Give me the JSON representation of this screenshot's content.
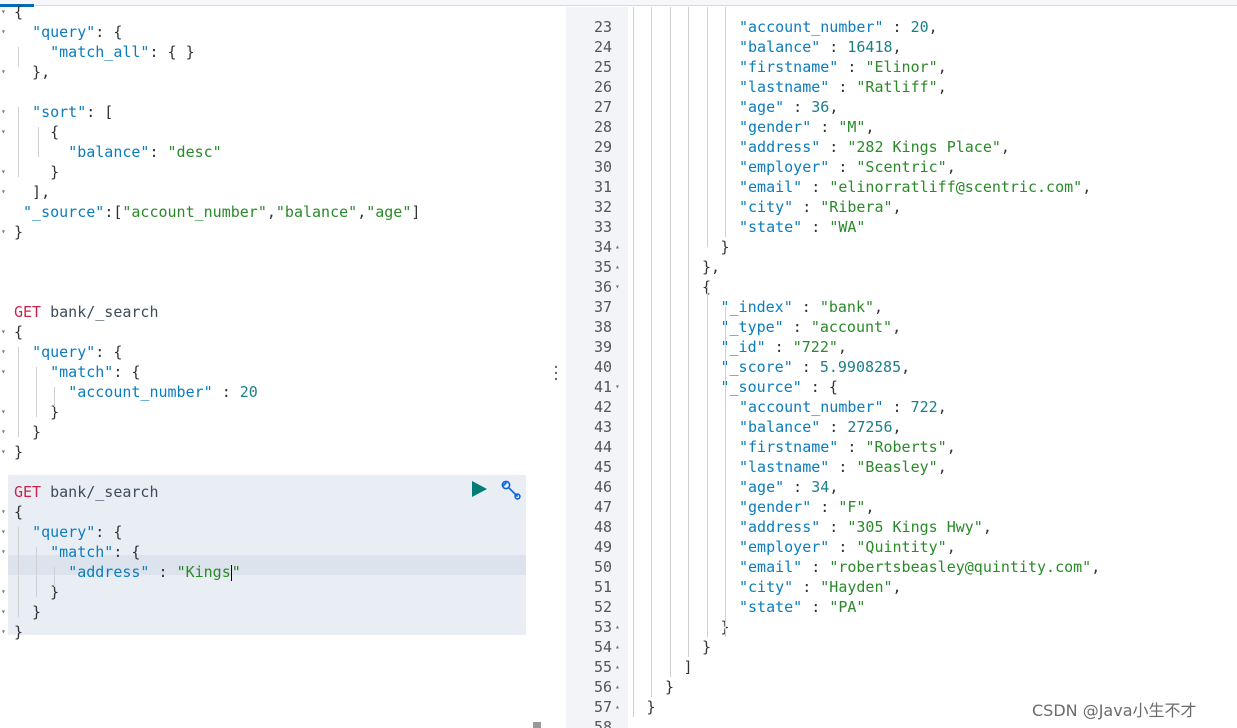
{
  "request_editor": {
    "lines": [
      {
        "i": 0,
        "fold": true,
        "parts": [
          [
            "p",
            "{"
          ]
        ]
      },
      {
        "i": 1,
        "fold": true,
        "parts": [
          [
            "p",
            "  "
          ],
          [
            "k",
            "\"query\""
          ],
          [
            "p",
            ": {"
          ]
        ]
      },
      {
        "i": 2,
        "fold": false,
        "parts": [
          [
            "p",
            "    "
          ],
          [
            "k",
            "\"match_all\""
          ],
          [
            "p",
            ": { }"
          ]
        ]
      },
      {
        "i": 3,
        "fold": true,
        "parts": [
          [
            "p",
            "  },"
          ]
        ]
      },
      {
        "i": 4,
        "fold": false,
        "parts": [
          [
            "p",
            ""
          ]
        ]
      },
      {
        "i": 5,
        "fold": true,
        "parts": [
          [
            "p",
            "  "
          ],
          [
            "k",
            "\"sort\""
          ],
          [
            "p",
            ": ["
          ]
        ]
      },
      {
        "i": 6,
        "fold": true,
        "parts": [
          [
            "p",
            "    {"
          ]
        ]
      },
      {
        "i": 7,
        "fold": false,
        "parts": [
          [
            "p",
            "      "
          ],
          [
            "k",
            "\"balance\""
          ],
          [
            "p",
            ": "
          ],
          [
            "s",
            "\"desc\""
          ]
        ]
      },
      {
        "i": 8,
        "fold": true,
        "parts": [
          [
            "p",
            "    }"
          ]
        ]
      },
      {
        "i": 9,
        "fold": true,
        "parts": [
          [
            "p",
            "  ],"
          ]
        ]
      },
      {
        "i": 10,
        "fold": false,
        "parts": [
          [
            "p",
            " "
          ],
          [
            "k",
            "\"_source\""
          ],
          [
            "p",
            ":["
          ],
          [
            "s",
            "\"account_number\""
          ],
          [
            "p",
            ","
          ],
          [
            "s",
            "\"balance\""
          ],
          [
            "p",
            ","
          ],
          [
            "s",
            "\"age\""
          ],
          [
            "p",
            "]"
          ]
        ]
      },
      {
        "i": 11,
        "fold": true,
        "parts": [
          [
            "p",
            "}"
          ]
        ]
      },
      {
        "i": 12,
        "fold": false,
        "parts": [
          [
            "p",
            ""
          ]
        ]
      },
      {
        "i": 13,
        "fold": false,
        "parts": [
          [
            "p",
            ""
          ]
        ]
      },
      {
        "i": 14,
        "fold": false,
        "parts": [
          [
            "p",
            ""
          ]
        ]
      },
      {
        "i": 15,
        "fold": false,
        "parts": [
          [
            "m",
            "GET"
          ],
          [
            "p",
            " "
          ],
          [
            "u",
            "bank/_search"
          ]
        ]
      },
      {
        "i": 16,
        "fold": true,
        "parts": [
          [
            "p",
            "{"
          ]
        ]
      },
      {
        "i": 17,
        "fold": true,
        "parts": [
          [
            "p",
            "  "
          ],
          [
            "k",
            "\"query\""
          ],
          [
            "p",
            ": {"
          ]
        ]
      },
      {
        "i": 18,
        "fold": true,
        "parts": [
          [
            "p",
            "    "
          ],
          [
            "k",
            "\"match\""
          ],
          [
            "p",
            ": {"
          ]
        ]
      },
      {
        "i": 19,
        "fold": false,
        "parts": [
          [
            "p",
            "      "
          ],
          [
            "k",
            "\"account_number\""
          ],
          [
            "p",
            " : "
          ],
          [
            "n",
            "20"
          ]
        ]
      },
      {
        "i": 20,
        "fold": true,
        "parts": [
          [
            "p",
            "    }"
          ]
        ]
      },
      {
        "i": 21,
        "fold": true,
        "parts": [
          [
            "p",
            "  }"
          ]
        ]
      },
      {
        "i": 22,
        "fold": true,
        "parts": [
          [
            "p",
            "}"
          ]
        ]
      },
      {
        "i": 23,
        "fold": false,
        "parts": [
          [
            "p",
            ""
          ]
        ]
      },
      {
        "i": 24,
        "fold": false,
        "parts": [
          [
            "m",
            "GET"
          ],
          [
            "p",
            " "
          ],
          [
            "u",
            "bank/_search"
          ]
        ]
      },
      {
        "i": 25,
        "fold": true,
        "parts": [
          [
            "p",
            "{"
          ]
        ]
      },
      {
        "i": 26,
        "fold": true,
        "parts": [
          [
            "p",
            "  "
          ],
          [
            "k",
            "\"query\""
          ],
          [
            "p",
            ": {"
          ]
        ]
      },
      {
        "i": 27,
        "fold": true,
        "parts": [
          [
            "p",
            "    "
          ],
          [
            "k",
            "\"match\""
          ],
          [
            "p",
            ": {"
          ]
        ]
      },
      {
        "i": 28,
        "fold": false,
        "parts": [
          [
            "p",
            "      "
          ],
          [
            "k",
            "\"address\""
          ],
          [
            "p",
            " : "
          ],
          [
            "s",
            "\"Kings"
          ],
          [
            "cursor",
            ""
          ],
          [
            "s",
            "\""
          ]
        ]
      },
      {
        "i": 29,
        "fold": true,
        "parts": [
          [
            "p",
            "    }"
          ]
        ]
      },
      {
        "i": 30,
        "fold": true,
        "parts": [
          [
            "p",
            "  }"
          ]
        ]
      },
      {
        "i": 31,
        "fold": true,
        "parts": [
          [
            "p",
            "}"
          ]
        ]
      }
    ]
  },
  "response_viewer": {
    "lines": [
      {
        "n": "23",
        "fold": "",
        "ind": 6,
        "parts": [
          [
            "k",
            "\"account_number\""
          ],
          [
            "p",
            " : "
          ],
          [
            "n",
            "20"
          ],
          [
            "p",
            ","
          ]
        ]
      },
      {
        "n": "24",
        "fold": "",
        "ind": 6,
        "parts": [
          [
            "k",
            "\"balance\""
          ],
          [
            "p",
            " : "
          ],
          [
            "n",
            "16418"
          ],
          [
            "p",
            ","
          ]
        ]
      },
      {
        "n": "25",
        "fold": "",
        "ind": 6,
        "parts": [
          [
            "k",
            "\"firstname\""
          ],
          [
            "p",
            " : "
          ],
          [
            "s",
            "\"Elinor\""
          ],
          [
            "p",
            ","
          ]
        ]
      },
      {
        "n": "26",
        "fold": "",
        "ind": 6,
        "parts": [
          [
            "k",
            "\"lastname\""
          ],
          [
            "p",
            " : "
          ],
          [
            "s",
            "\"Ratliff\""
          ],
          [
            "p",
            ","
          ]
        ]
      },
      {
        "n": "27",
        "fold": "",
        "ind": 6,
        "parts": [
          [
            "k",
            "\"age\""
          ],
          [
            "p",
            " : "
          ],
          [
            "n",
            "36"
          ],
          [
            "p",
            ","
          ]
        ]
      },
      {
        "n": "28",
        "fold": "",
        "ind": 6,
        "parts": [
          [
            "k",
            "\"gender\""
          ],
          [
            "p",
            " : "
          ],
          [
            "s",
            "\"M\""
          ],
          [
            "p",
            ","
          ]
        ]
      },
      {
        "n": "29",
        "fold": "",
        "ind": 6,
        "parts": [
          [
            "k",
            "\"address\""
          ],
          [
            "p",
            " : "
          ],
          [
            "s",
            "\"282 Kings Place\""
          ],
          [
            "p",
            ","
          ]
        ]
      },
      {
        "n": "30",
        "fold": "",
        "ind": 6,
        "parts": [
          [
            "k",
            "\"employer\""
          ],
          [
            "p",
            " : "
          ],
          [
            "s",
            "\"Scentric\""
          ],
          [
            "p",
            ","
          ]
        ]
      },
      {
        "n": "31",
        "fold": "",
        "ind": 6,
        "parts": [
          [
            "k",
            "\"email\""
          ],
          [
            "p",
            " : "
          ],
          [
            "s",
            "\"elinorratliff@scentric.com\""
          ],
          [
            "p",
            ","
          ]
        ]
      },
      {
        "n": "32",
        "fold": "",
        "ind": 6,
        "parts": [
          [
            "k",
            "\"city\""
          ],
          [
            "p",
            " : "
          ],
          [
            "s",
            "\"Ribera\""
          ],
          [
            "p",
            ","
          ]
        ]
      },
      {
        "n": "33",
        "fold": "",
        "ind": 6,
        "parts": [
          [
            "k",
            "\"state\""
          ],
          [
            "p",
            " : "
          ],
          [
            "s",
            "\"WA\""
          ]
        ]
      },
      {
        "n": "34",
        "fold": "up",
        "ind": 5,
        "parts": [
          [
            "p",
            "}"
          ]
        ]
      },
      {
        "n": "35",
        "fold": "up",
        "ind": 4,
        "parts": [
          [
            "p",
            "},"
          ]
        ]
      },
      {
        "n": "36",
        "fold": "down",
        "ind": 4,
        "parts": [
          [
            "p",
            "{"
          ]
        ]
      },
      {
        "n": "37",
        "fold": "",
        "ind": 5,
        "parts": [
          [
            "k",
            "\"_index\""
          ],
          [
            "p",
            " : "
          ],
          [
            "s",
            "\"bank\""
          ],
          [
            "p",
            ","
          ]
        ]
      },
      {
        "n": "38",
        "fold": "",
        "ind": 5,
        "parts": [
          [
            "k",
            "\"_type\""
          ],
          [
            "p",
            " : "
          ],
          [
            "s",
            "\"account\""
          ],
          [
            "p",
            ","
          ]
        ]
      },
      {
        "n": "39",
        "fold": "",
        "ind": 5,
        "parts": [
          [
            "k",
            "\"_id\""
          ],
          [
            "p",
            " : "
          ],
          [
            "s",
            "\"722\""
          ],
          [
            "p",
            ","
          ]
        ]
      },
      {
        "n": "40",
        "fold": "",
        "ind": 5,
        "parts": [
          [
            "k",
            "\"_score\""
          ],
          [
            "p",
            " : "
          ],
          [
            "n",
            "5.9908285"
          ],
          [
            "p",
            ","
          ]
        ]
      },
      {
        "n": "41",
        "fold": "down",
        "ind": 5,
        "parts": [
          [
            "k",
            "\"_source\""
          ],
          [
            "p",
            " : {"
          ]
        ]
      },
      {
        "n": "42",
        "fold": "",
        "ind": 6,
        "parts": [
          [
            "k",
            "\"account_number\""
          ],
          [
            "p",
            " : "
          ],
          [
            "n",
            "722"
          ],
          [
            "p",
            ","
          ]
        ]
      },
      {
        "n": "43",
        "fold": "",
        "ind": 6,
        "parts": [
          [
            "k",
            "\"balance\""
          ],
          [
            "p",
            " : "
          ],
          [
            "n",
            "27256"
          ],
          [
            "p",
            ","
          ]
        ]
      },
      {
        "n": "44",
        "fold": "",
        "ind": 6,
        "parts": [
          [
            "k",
            "\"firstname\""
          ],
          [
            "p",
            " : "
          ],
          [
            "s",
            "\"Roberts\""
          ],
          [
            "p",
            ","
          ]
        ]
      },
      {
        "n": "45",
        "fold": "",
        "ind": 6,
        "parts": [
          [
            "k",
            "\"lastname\""
          ],
          [
            "p",
            " : "
          ],
          [
            "s",
            "\"Beasley\""
          ],
          [
            "p",
            ","
          ]
        ]
      },
      {
        "n": "46",
        "fold": "",
        "ind": 6,
        "parts": [
          [
            "k",
            "\"age\""
          ],
          [
            "p",
            " : "
          ],
          [
            "n",
            "34"
          ],
          [
            "p",
            ","
          ]
        ]
      },
      {
        "n": "47",
        "fold": "",
        "ind": 6,
        "parts": [
          [
            "k",
            "\"gender\""
          ],
          [
            "p",
            " : "
          ],
          [
            "s",
            "\"F\""
          ],
          [
            "p",
            ","
          ]
        ]
      },
      {
        "n": "48",
        "fold": "",
        "ind": 6,
        "parts": [
          [
            "k",
            "\"address\""
          ],
          [
            "p",
            " : "
          ],
          [
            "s",
            "\"305 Kings Hwy\""
          ],
          [
            "p",
            ","
          ]
        ]
      },
      {
        "n": "49",
        "fold": "",
        "ind": 6,
        "parts": [
          [
            "k",
            "\"employer\""
          ],
          [
            "p",
            " : "
          ],
          [
            "s",
            "\"Quintity\""
          ],
          [
            "p",
            ","
          ]
        ]
      },
      {
        "n": "50",
        "fold": "",
        "ind": 6,
        "parts": [
          [
            "k",
            "\"email\""
          ],
          [
            "p",
            " : "
          ],
          [
            "s",
            "\"robertsbeasley@quintity.com\""
          ],
          [
            "p",
            ","
          ]
        ]
      },
      {
        "n": "51",
        "fold": "",
        "ind": 6,
        "parts": [
          [
            "k",
            "\"city\""
          ],
          [
            "p",
            " : "
          ],
          [
            "s",
            "\"Hayden\""
          ],
          [
            "p",
            ","
          ]
        ]
      },
      {
        "n": "52",
        "fold": "",
        "ind": 6,
        "parts": [
          [
            "k",
            "\"state\""
          ],
          [
            "p",
            " : "
          ],
          [
            "s",
            "\"PA\""
          ]
        ]
      },
      {
        "n": "53",
        "fold": "up",
        "ind": 5,
        "parts": [
          [
            "p",
            "}"
          ]
        ]
      },
      {
        "n": "54",
        "fold": "up",
        "ind": 4,
        "parts": [
          [
            "p",
            "}"
          ]
        ]
      },
      {
        "n": "55",
        "fold": "up",
        "ind": 3,
        "parts": [
          [
            "p",
            "]"
          ]
        ]
      },
      {
        "n": "56",
        "fold": "up",
        "ind": 2,
        "parts": [
          [
            "p",
            "}"
          ]
        ]
      },
      {
        "n": "57",
        "fold": "up",
        "ind": 1,
        "parts": [
          [
            "p",
            "}"
          ]
        ]
      },
      {
        "n": "58",
        "fold": "",
        "ind": 0,
        "parts": [
          [
            "p",
            ""
          ]
        ]
      }
    ]
  },
  "icons": {
    "run": "play-icon",
    "wrench": "wrench-icon",
    "splitter": "vertical-ellipsis-icon"
  },
  "colors": {
    "keys": "#0b7dbe",
    "strings": "#2a8a2a",
    "numbers": "#1a7f8a",
    "method": "#c7254e",
    "run_button": "#017d73"
  },
  "watermark": "CSDN @Java小生不才"
}
